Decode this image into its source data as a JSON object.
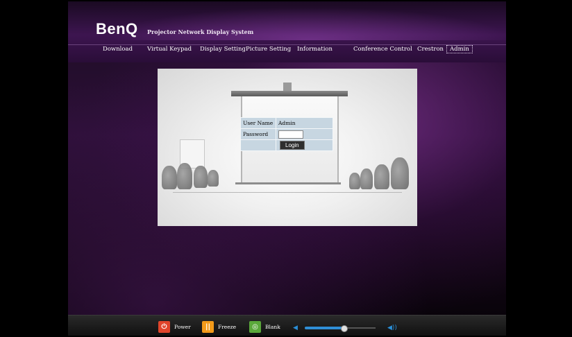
{
  "header": {
    "logo": "BenQ",
    "subtitle": "Projector Network Display System"
  },
  "nav": {
    "items": [
      {
        "label": "Download"
      },
      {
        "label": "Virtual Keypad"
      },
      {
        "label": "Display Setting"
      },
      {
        "label": "Picture Setting"
      },
      {
        "label": "Information"
      },
      {
        "label": "Conference Control"
      },
      {
        "label": "Crestron"
      },
      {
        "label": "Admin"
      }
    ],
    "active": "Admin"
  },
  "login": {
    "username_label": "User Name",
    "username_value": "Admin",
    "password_label": "Password",
    "password_value": "",
    "login_button": "Login"
  },
  "controls": {
    "power_label": "Power",
    "freeze_label": "Freeze",
    "blank_label": "Blank",
    "power_color": "#e0452b",
    "freeze_color": "#f29a1a",
    "blank_color": "#5aa83a",
    "volume_level": 0.55,
    "volume_color": "#2f8ed6"
  }
}
